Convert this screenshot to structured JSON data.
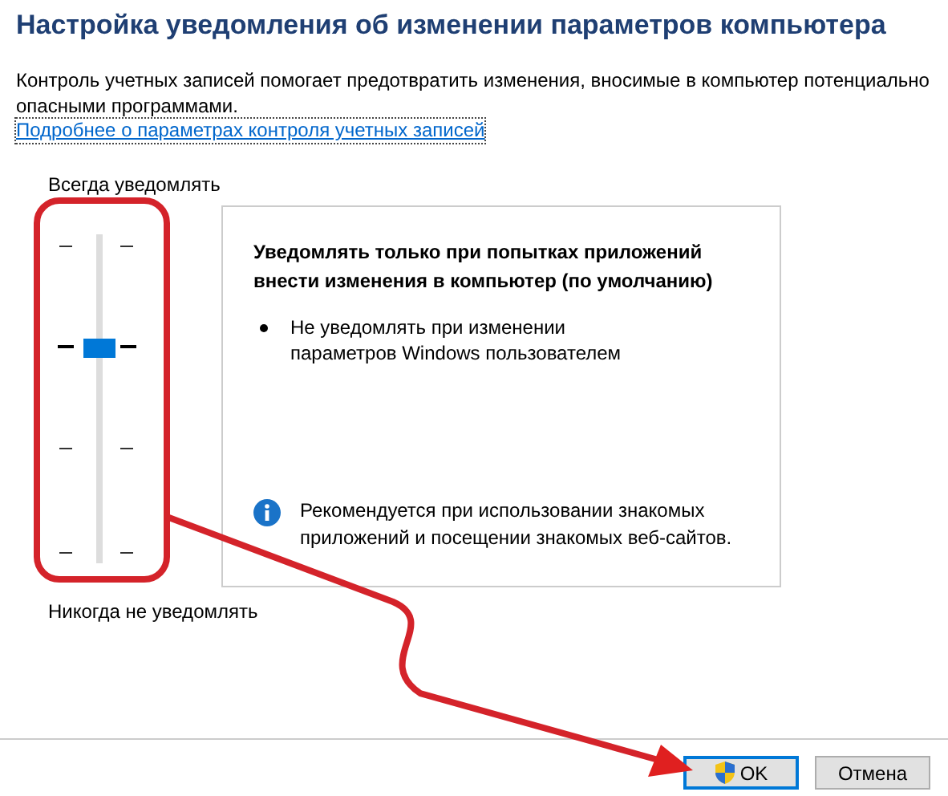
{
  "header": {
    "title": "Настройка уведомления об изменении параметров компьютера",
    "description": "Контроль учетных записей помогает предотвратить изменения, вносимые в компьютер потенциально опасными программами.",
    "link": "Подробнее о параметрах контроля учетных записей"
  },
  "slider": {
    "top_label": "Всегда уведомлять",
    "bottom_label": "Никогда не уведомлять",
    "level": 0.6667
  },
  "info_panel": {
    "heading": "Уведомлять только при попытках приложений внести изменения в компьютер (по умолчанию)",
    "bullets": [
      "Не уведомлять при изменении параметров Windows пользователем"
    ],
    "note": "Рекомендуется при использовании знакомых приложений и посещении знакомых веб-сайтов."
  },
  "buttons": [
    {
      "label": "OK",
      "kind": "shield",
      "focused": true
    },
    {
      "label": "Отмена",
      "kind": "plain",
      "focused": false
    }
  ]
}
